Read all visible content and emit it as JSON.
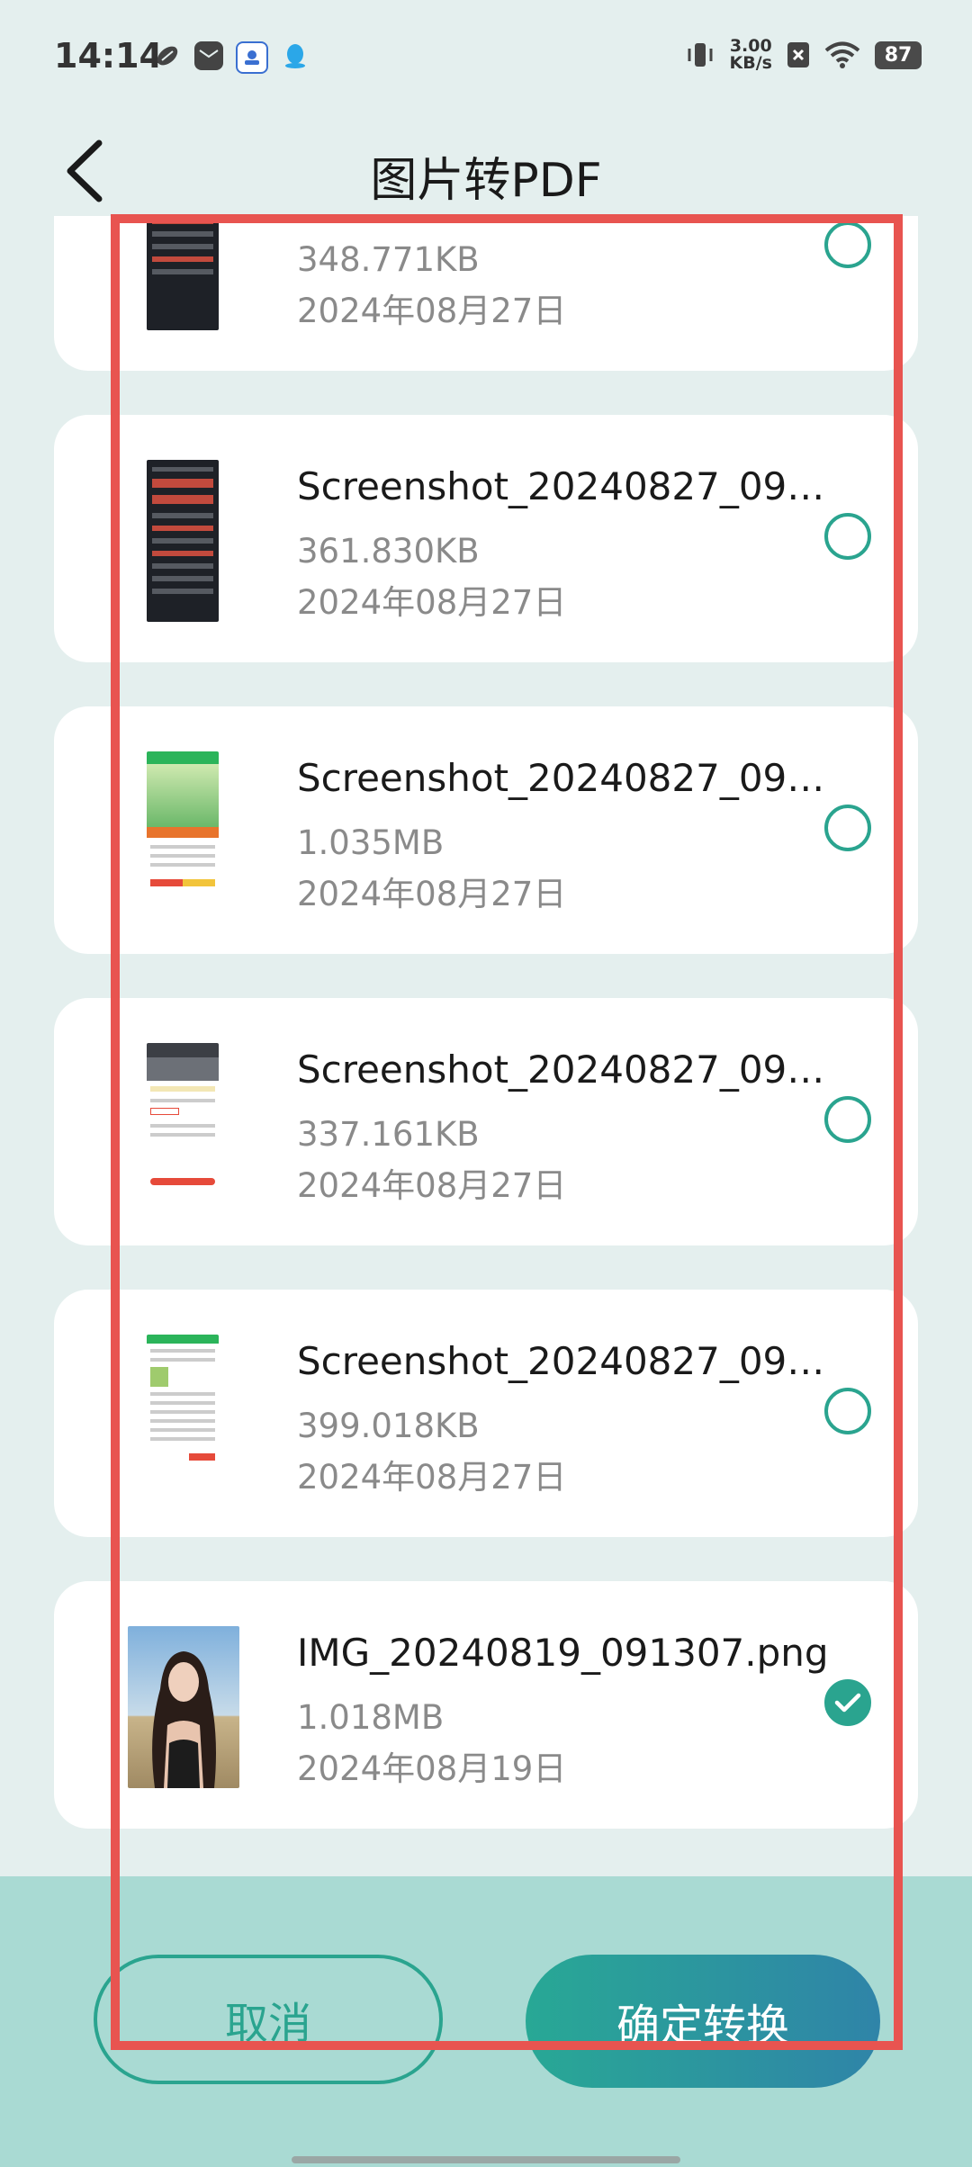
{
  "status_bar": {
    "time": "14:14",
    "net_speed_value": "3.00",
    "net_speed_unit": "KB/s",
    "battery": "87"
  },
  "header": {
    "title": "图片转PDF"
  },
  "files": [
    {
      "name": "",
      "size": "348.771KB",
      "date": "2024年08月27日",
      "selected": false
    },
    {
      "name": "Screenshot_20240827_09…",
      "size": "361.830KB",
      "date": "2024年08月27日",
      "selected": false
    },
    {
      "name": "Screenshot_20240827_09…",
      "size": "1.035MB",
      "date": "2024年08月27日",
      "selected": false
    },
    {
      "name": "Screenshot_20240827_09…",
      "size": "337.161KB",
      "date": "2024年08月27日",
      "selected": false
    },
    {
      "name": "Screenshot_20240827_09…",
      "size": "399.018KB",
      "date": "2024年08月27日",
      "selected": false
    },
    {
      "name": "IMG_20240819_091307.png",
      "size": "1.018MB",
      "date": "2024年08月19日",
      "selected": true
    }
  ],
  "actions": {
    "cancel_label": "取消",
    "confirm_label": "确定转换"
  },
  "colors": {
    "accent": "#2aa48f",
    "highlight": "#e85450",
    "bottom_bar": "#a9dad3"
  }
}
